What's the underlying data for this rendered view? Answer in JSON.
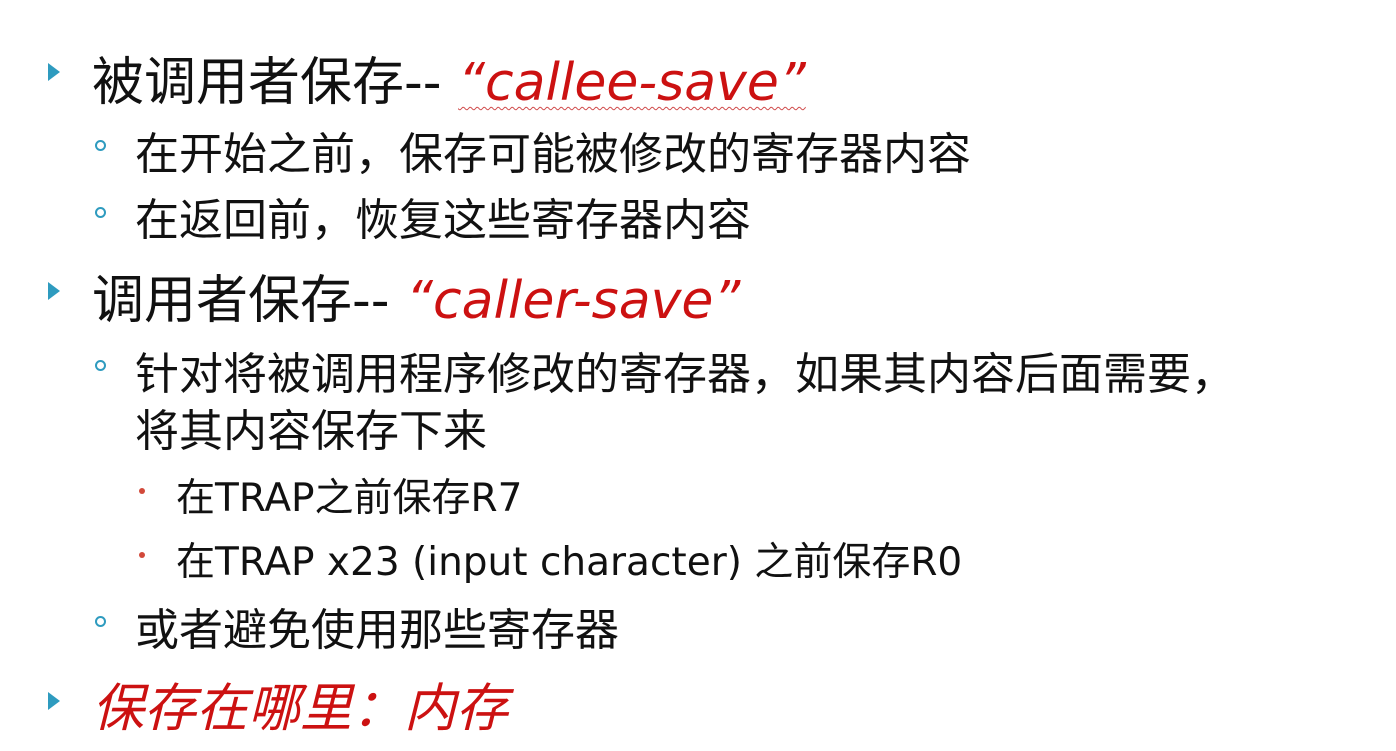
{
  "slide": {
    "accent_color": "#2e9bbf",
    "emphasis_color": "#cc1111",
    "items": [
      {
        "level": 1,
        "text": "被调用者保存--",
        "term": "“callee-save”"
      },
      {
        "level": 2,
        "text": "在开始之前，保存可能被修改的寄存器内容"
      },
      {
        "level": 2,
        "text": "在返回前，恢复这些寄存器内容"
      },
      {
        "level": 1,
        "text": "调用者保存--",
        "term": "“caller-save”"
      },
      {
        "level": 2,
        "text": "针对将被调用程序修改的寄存器，如果其内容后面需要，",
        "continuation": "将其内容保存下来"
      },
      {
        "level": 3,
        "text": "在TRAP之前保存R7"
      },
      {
        "level": 3,
        "text": "在TRAP x23 (input character) 之前保存R0"
      },
      {
        "level": 2,
        "text": "或者避免使用那些寄存器"
      },
      {
        "level": 1,
        "emphasis_text": "保存在哪里：内存"
      }
    ]
  }
}
